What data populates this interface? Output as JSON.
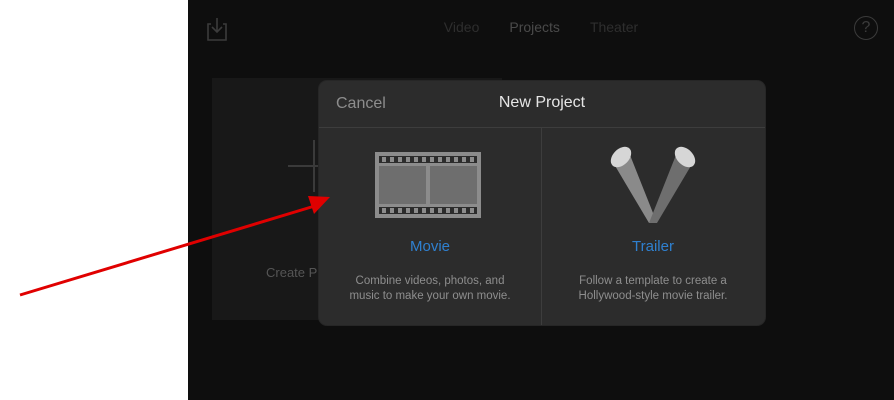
{
  "topbar": {
    "tabs": [
      {
        "label": "Video",
        "active": false
      },
      {
        "label": "Projects",
        "active": true
      },
      {
        "label": "Theater",
        "active": false
      }
    ],
    "import_icon": "import-icon",
    "help_label": "?"
  },
  "background": {
    "create_label": "Create P"
  },
  "dialog": {
    "cancel_label": "Cancel",
    "title": "New Project",
    "options": [
      {
        "icon": "film-strip-icon",
        "label": "Movie",
        "description_line1": "Combine videos, photos, and",
        "description_line2": "music to make your own movie."
      },
      {
        "icon": "spotlights-icon",
        "label": "Trailer",
        "description_line1": "Follow a template to create a",
        "description_line2": "Hollywood-style movie trailer."
      }
    ]
  },
  "annotation": {
    "arrow_color": "#e00000"
  },
  "colors": {
    "accent": "#2f80d0",
    "background": "#0e0e0e",
    "dialog": "#2c2c2c"
  }
}
